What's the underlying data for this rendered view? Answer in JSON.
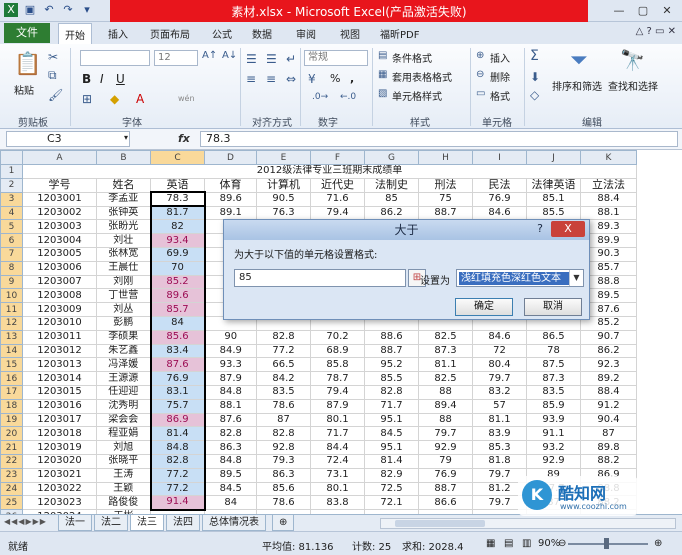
{
  "window": {
    "title": "素材.xlsx - Microsoft Excel(产品激活失败)",
    "qat_icons": [
      "excel-logo-icon",
      "save-icon",
      "undo-icon",
      "redo-icon",
      "customize-icon"
    ]
  },
  "ribbon": {
    "file_tab": "文件",
    "tabs": [
      "开始",
      "插入",
      "页面布局",
      "公式",
      "数据",
      "审阅",
      "视图",
      "福昕PDF"
    ],
    "active_tab": "开始",
    "groups": {
      "clipboard": {
        "label": "剪贴板",
        "paste": "粘贴"
      },
      "font": {
        "label": "字体",
        "font_size": "12",
        "bold": "B",
        "italic": "I",
        "underline": "U",
        "wen": "wén"
      },
      "alignment": {
        "label": "对齐方式"
      },
      "number": {
        "label": "数字",
        "format": "常规",
        "percent": "%",
        "comma": ","
      },
      "styles": {
        "label": "样式",
        "conditional": "条件格式",
        "table": "套用表格格式",
        "cell": "单元格样式"
      },
      "cells": {
        "label": "单元格",
        "insert": "插入",
        "delete": "删除",
        "format": "格式"
      },
      "editing": {
        "label": "编辑",
        "sort": "排序和筛选",
        "find": "查找和选择"
      }
    }
  },
  "formula_bar": {
    "name_box": "C3",
    "fx": "fx",
    "content": "78.3"
  },
  "sheet": {
    "columns": [
      "A",
      "B",
      "C",
      "D",
      "E",
      "F",
      "G",
      "H",
      "I",
      "J",
      "K"
    ],
    "title": "2012级法律专业三班期末成绩单",
    "headers": [
      "学号",
      "姓名",
      "英语",
      "体育",
      "计算机",
      "近代史",
      "法制史",
      "刑法",
      "民法",
      "法律英语",
      "立法法"
    ],
    "rows": [
      {
        "r": "3",
        "c": [
          "1203001",
          "李孟亚",
          "78.3",
          "89.6",
          "90.5",
          "71.6",
          "85",
          "75",
          "76.9",
          "85.1",
          "88.4"
        ]
      },
      {
        "r": "4",
        "c": [
          "1203002",
          "张钟英",
          "81.7",
          "89.1",
          "76.3",
          "79.4",
          "86.2",
          "88.7",
          "84.6",
          "85.5",
          "88.1"
        ]
      },
      {
        "r": "5",
        "c": [
          "1203003",
          "张盼光",
          "82",
          "",
          "",
          "",
          "",
          "",
          "",
          "",
          "89.3"
        ]
      },
      {
        "r": "6",
        "c": [
          "1203004",
          "刘壮",
          "93.4",
          "",
          "",
          "",
          "",
          "",
          "",
          "",
          "89.9"
        ]
      },
      {
        "r": "7",
        "c": [
          "1203005",
          "张林宽",
          "69.9",
          "",
          "",
          "",
          "",
          "",
          "",
          "",
          "90.3"
        ]
      },
      {
        "r": "8",
        "c": [
          "1203006",
          "王晨仕",
          "70",
          "",
          "",
          "",
          "",
          "",
          "",
          "",
          "85.7"
        ]
      },
      {
        "r": "9",
        "c": [
          "1203007",
          "刘刚",
          "85.2",
          "",
          "",
          "",
          "",
          "",
          "",
          "",
          "88.8"
        ]
      },
      {
        "r": "10",
        "c": [
          "1203008",
          "丁世营",
          "89.6",
          "",
          "",
          "",
          "",
          "",
          "",
          "",
          "89.5"
        ]
      },
      {
        "r": "11",
        "c": [
          "1203009",
          "刘丛",
          "85.7",
          "",
          "",
          "",
          "",
          "",
          "",
          "",
          "87.6"
        ]
      },
      {
        "r": "12",
        "c": [
          "1203010",
          "彭鹏",
          "84",
          "",
          "",
          "",
          "",
          "",
          "",
          "",
          "85.2"
        ]
      },
      {
        "r": "13",
        "c": [
          "1203011",
          "李硕果",
          "85.6",
          "90",
          "82.8",
          "70.2",
          "88.6",
          "82.5",
          "84.6",
          "86.5",
          "90.7"
        ]
      },
      {
        "r": "14",
        "c": [
          "1203012",
          "朱艺鑫",
          "83.4",
          "84.9",
          "77.2",
          "68.9",
          "88.7",
          "87.3",
          "72",
          "78",
          "86.2"
        ]
      },
      {
        "r": "15",
        "c": [
          "1203013",
          "冯泽媛",
          "87.6",
          "93.3",
          "66.5",
          "85.8",
          "95.2",
          "81.1",
          "80.4",
          "87.5",
          "92.3"
        ]
      },
      {
        "r": "16",
        "c": [
          "1203014",
          "王源源",
          "76.9",
          "87.9",
          "84.2",
          "78.7",
          "85.5",
          "82.5",
          "79.7",
          "87.3",
          "89.2"
        ]
      },
      {
        "r": "17",
        "c": [
          "1203015",
          "任迎迎",
          "83.1",
          "84.8",
          "83.5",
          "79.4",
          "82.8",
          "88",
          "83.2",
          "83.5",
          "88.4"
        ]
      },
      {
        "r": "18",
        "c": [
          "1203016",
          "沈秀明",
          "75.7",
          "88.1",
          "78.6",
          "87.9",
          "71.7",
          "89.4",
          "57",
          "85.9",
          "91.2"
        ]
      },
      {
        "r": "19",
        "c": [
          "1203017",
          "梁会会",
          "86.9",
          "87.6",
          "87",
          "80.1",
          "95.1",
          "88",
          "81.1",
          "93.9",
          "90.4"
        ]
      },
      {
        "r": "20",
        "c": [
          "1203018",
          "程亚娟",
          "81.4",
          "82.8",
          "82.8",
          "71.7",
          "84.5",
          "79.7",
          "83.9",
          "91.1",
          "87"
        ]
      },
      {
        "r": "21",
        "c": [
          "1203019",
          "刘旭",
          "84.8",
          "86.3",
          "92.8",
          "84.4",
          "95.1",
          "92.9",
          "85.3",
          "93.2",
          "89.8"
        ]
      },
      {
        "r": "22",
        "c": [
          "1203020",
          "张晓平",
          "82.8",
          "84.8",
          "79.3",
          "72.4",
          "81.4",
          "79",
          "81.8",
          "92.9",
          "88.2"
        ]
      },
      {
        "r": "23",
        "c": [
          "1203021",
          "王涛",
          "77.2",
          "89.5",
          "86.3",
          "73.1",
          "82.9",
          "76.9",
          "79.7",
          "89",
          "86.9"
        ]
      },
      {
        "r": "24",
        "c": [
          "1203022",
          "王颖",
          "77.2",
          "84.5",
          "85.6",
          "80.1",
          "72.5",
          "88.7",
          "81.2",
          "87.7",
          "88.8"
        ]
      },
      {
        "r": "25",
        "c": [
          "1203023",
          "路俊俊",
          "91.4",
          "84",
          "78.6",
          "83.8",
          "72.1",
          "86.6",
          "79.7",
          "87",
          "88.2"
        ]
      },
      {
        "r": "26",
        "c": [
          "1203024",
          "王彬",
          "",
          "",
          "",
          "",
          "",
          "",
          "",
          "",
          ""
        ]
      }
    ]
  },
  "dialog": {
    "title": "大于",
    "help": "?",
    "close": "X",
    "prompt": "为大于以下值的单元格设置格式:",
    "value": "85",
    "set_label": "设置为",
    "format_option": "浅红填充色深红色文本",
    "ok": "确定",
    "cancel": "取消"
  },
  "sheet_tabs": [
    "法一",
    "法二",
    "法三",
    "法四",
    "总体情况表"
  ],
  "active_sheet": "法三",
  "status": {
    "ready": "就绪",
    "average": "平均值: 81.136",
    "count": "计数: 25",
    "sum": "求和: 2028.4",
    "zoom": "90%"
  },
  "watermark": {
    "logo": "K",
    "text": "酷知网",
    "url": "www.coozhi.com"
  }
}
